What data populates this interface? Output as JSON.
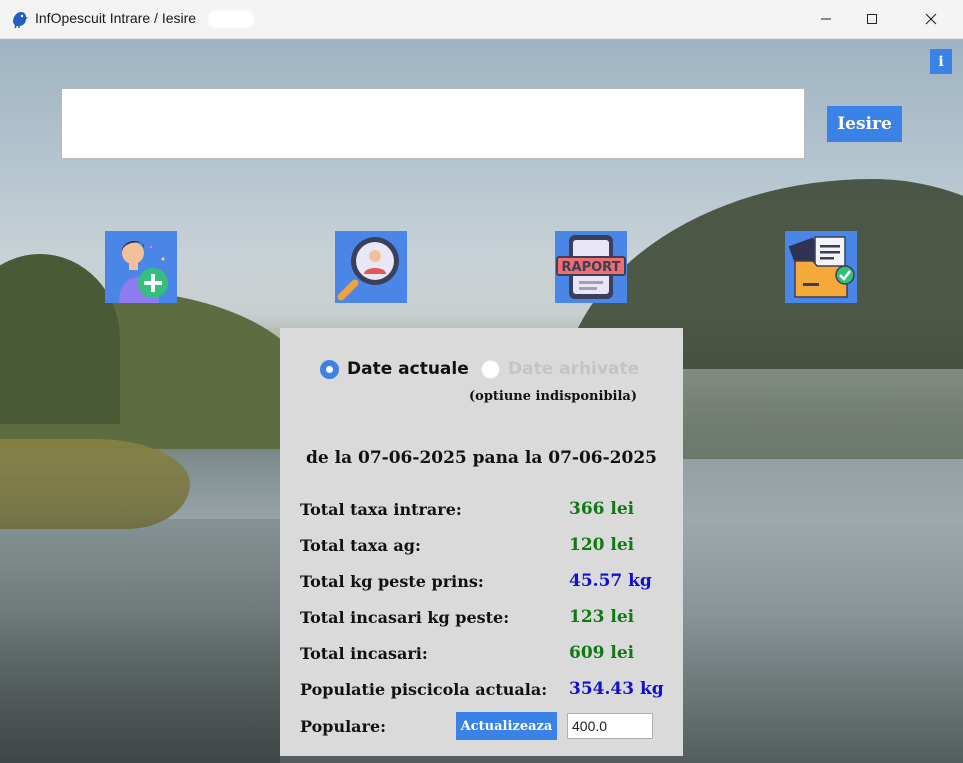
{
  "window": {
    "title": "InfOpescuit Intrare / Iesire",
    "icon": "bird-app-icon",
    "controls": [
      "minimize-icon",
      "maximize-icon",
      "close-icon"
    ]
  },
  "header": {
    "search_value": "",
    "exit_button": "Iesire",
    "info_button": "i"
  },
  "actions": [
    {
      "name": "add-person-icon",
      "color": "#4a86e8"
    },
    {
      "name": "search-person-icon",
      "color": "#4a86e8"
    },
    {
      "name": "report-icon",
      "color": "#4a86e8"
    },
    {
      "name": "documents-folder-icon",
      "color": "#4a86e8"
    }
  ],
  "panel": {
    "radio_current": "Date actuale",
    "radio_archived": "Date arhivate",
    "unavailable_note": "(optiune indisponibila)",
    "range": "de la 07-06-2025 pana la 07-06-2025",
    "stats": [
      {
        "label": "Total taxa intrare:",
        "value": "366 lei",
        "color": "green"
      },
      {
        "label": "Total taxa ag:",
        "value": "120 lei",
        "color": "green"
      },
      {
        "label": "Total kg peste prins:",
        "value": "45.57 kg",
        "color": "blue"
      },
      {
        "label": "Total incasari kg peste:",
        "value": "123 lei",
        "color": "green"
      },
      {
        "label": "Total incasari:",
        "value": "609 lei",
        "color": "green"
      },
      {
        "label": "Populatie piscicola actuala:",
        "value": "354.43 kg",
        "color": "blue"
      }
    ],
    "population_label": "Populare:",
    "update_button": "Actualizeaza",
    "population_value": "400.0"
  },
  "colors": {
    "accent": "#3b82e6",
    "value_green": "#0f7a14",
    "value_blue": "#1111cc",
    "panel_bg": "#dadada"
  }
}
